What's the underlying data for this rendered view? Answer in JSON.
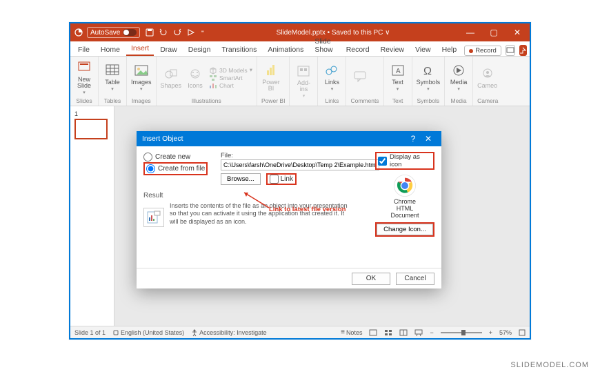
{
  "titlebar": {
    "autosave": "AutoSave",
    "title": "SlideModel.pptx • Saved to this PC ∨"
  },
  "menu": {
    "file": "File",
    "home": "Home",
    "insert": "Insert",
    "draw": "Draw",
    "design": "Design",
    "transitions": "Transitions",
    "animations": "Animations",
    "slideshow": "Slide Show",
    "record_tab": "Record",
    "review": "Review",
    "view": "View",
    "help": "Help",
    "record_btn": "Record"
  },
  "ribbon": {
    "newslide": "New\nSlide",
    "table": "Table",
    "images": "Images",
    "shapes": "Shapes",
    "icons": "Icons",
    "models3d": "3D Models",
    "smartart": "SmartArt",
    "chart": "Chart",
    "powerbi": "Power\nBI",
    "addins": "Add-\nins",
    "links": "Links",
    "comment": " ",
    "text": "Text",
    "symbols": "Symbols",
    "media": "Media",
    "cameo": "Cameo",
    "g_slides": "Slides",
    "g_tables": "Tables",
    "g_images": "Images",
    "g_illus": "Illustrations",
    "g_pbi": "Power BI",
    "g_add": " ",
    "g_links": "Links",
    "g_comm": "Comments",
    "g_text": "Text",
    "g_sym": "Symbols",
    "g_media": "Media",
    "g_cam": "Camera"
  },
  "thumb": {
    "num": "1"
  },
  "status": {
    "slide": "Slide 1 of 1",
    "lang": "English (United States)",
    "access": "Accessibility: Investigate",
    "notes": "Notes",
    "zoom": "57%"
  },
  "dialog": {
    "title": "Insert Object",
    "create_new": "Create new",
    "create_from_file": "Create from file",
    "file_label": "File:",
    "file_value": "C:\\Users\\farsh\\OneDrive\\Desktop\\Temp 2\\Example.html",
    "browse": "Browse...",
    "link": "Link",
    "display_as_icon": "Display as icon",
    "icon_caption": "Chrome\nHTML\nDocument",
    "change_icon": "Change Icon...",
    "result": "Result",
    "result_text": "Inserts the contents of the file as an object into your presentation so that you can activate it using the application that created it. It will be displayed as an icon.",
    "callout": "Link to latest file version",
    "ok": "OK",
    "cancel": "Cancel"
  },
  "watermark": "SLIDEMODEL.COM"
}
